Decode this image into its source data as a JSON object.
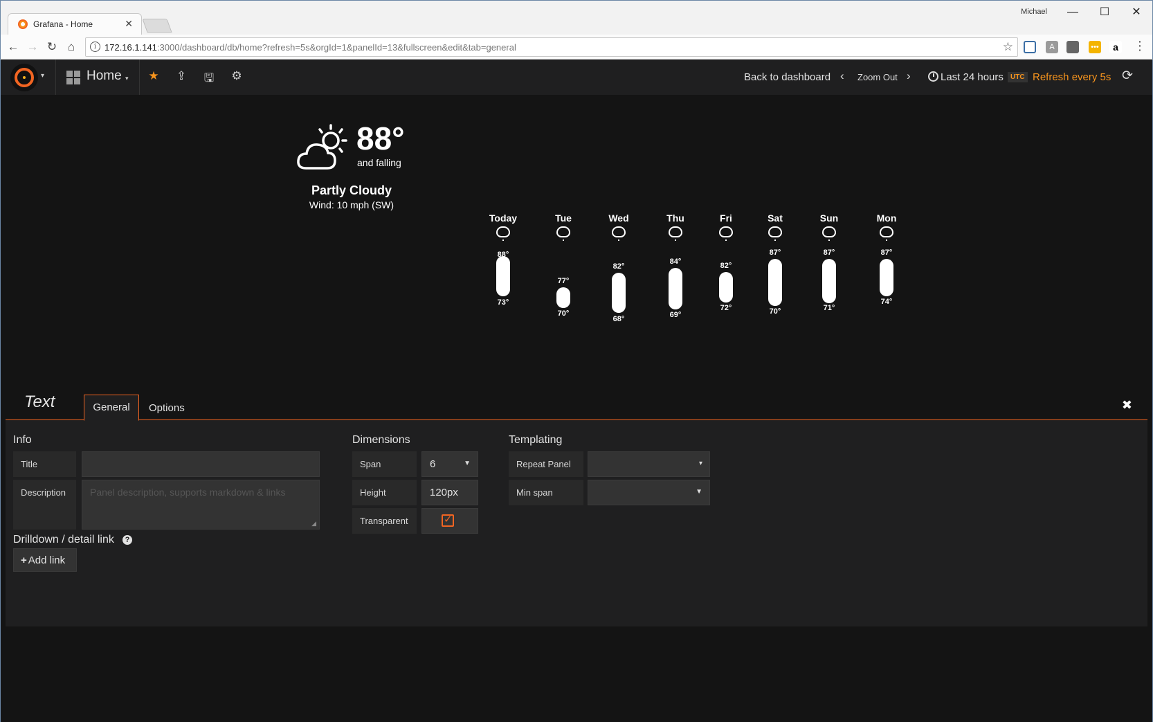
{
  "browser": {
    "tab_title": "Grafana - Home",
    "tab_close": "✕",
    "user": "Michael",
    "window_buttons": {
      "minimize": "—",
      "maximize": "☐",
      "close": "✕"
    },
    "url_host": "172.16.1.141",
    "url_rest": ":3000/dashboard/db/home?refresh=5s&orgId=1&panelId=13&fullscreen&edit&tab=general",
    "nav": {
      "back": "←",
      "forward": "→",
      "reload": "↻",
      "home": "⌂",
      "star": "☆",
      "menu": "⋮",
      "info": "i"
    },
    "extensions": [
      "",
      "A",
      "",
      "•••",
      "a"
    ]
  },
  "grafana": {
    "dashboard_title": "Home",
    "back_to_dashboard": "Back to dashboard",
    "zoom_out": "Zoom Out",
    "time_range": "Last 24 hours",
    "timezone": "UTC",
    "refresh": "Refresh every 5s",
    "icons": {
      "prev": "‹",
      "next": "›",
      "refresh": "⟳",
      "star": "★",
      "share": "⇪",
      "save": "🖫",
      "settings": "⚙",
      "caret": "▾"
    }
  },
  "weather": {
    "temp": "88°",
    "trend": "and falling",
    "condition": "Partly Cloudy",
    "wind": "Wind: 10 mph (SW)",
    "forecast": [
      {
        "day": "Today",
        "hi": "88°",
        "lo": "73°"
      },
      {
        "day": "Tue",
        "hi": "77°",
        "lo": "70°"
      },
      {
        "day": "Wed",
        "hi": "82°",
        "lo": "68°"
      },
      {
        "day": "Thu",
        "hi": "84°",
        "lo": "69°"
      },
      {
        "day": "Fri",
        "hi": "82°",
        "lo": "72°"
      },
      {
        "day": "Sat",
        "hi": "87°",
        "lo": "70°"
      },
      {
        "day": "Sun",
        "hi": "87°",
        "lo": "71°"
      },
      {
        "day": "Mon",
        "hi": "87°",
        "lo": "74°"
      }
    ]
  },
  "editor": {
    "panel_type": "Text",
    "tabs": [
      "General",
      "Options"
    ],
    "close": "✖",
    "info": {
      "title": "Info",
      "title_label": "Title",
      "title_value": "",
      "description_label": "Description",
      "description_placeholder": "Panel description, supports markdown & links"
    },
    "dimensions": {
      "title": "Dimensions",
      "span_label": "Span",
      "span_value": "6",
      "height_label": "Height",
      "height_value": "120px",
      "transparent_label": "Transparent",
      "transparent_checked": true
    },
    "templating": {
      "title": "Templating",
      "repeat_label": "Repeat Panel",
      "repeat_value": "",
      "min_span_label": "Min span",
      "min_span_value": ""
    },
    "drilldown": {
      "title": "Drilldown / detail link",
      "help": "?",
      "add_link_plus": "+",
      "add_link": "Add link"
    }
  },
  "colors": {
    "accent": "#f26522",
    "orange_text": "#f7941d",
    "panel_bg": "#1f1f20",
    "page_bg": "#141414"
  }
}
